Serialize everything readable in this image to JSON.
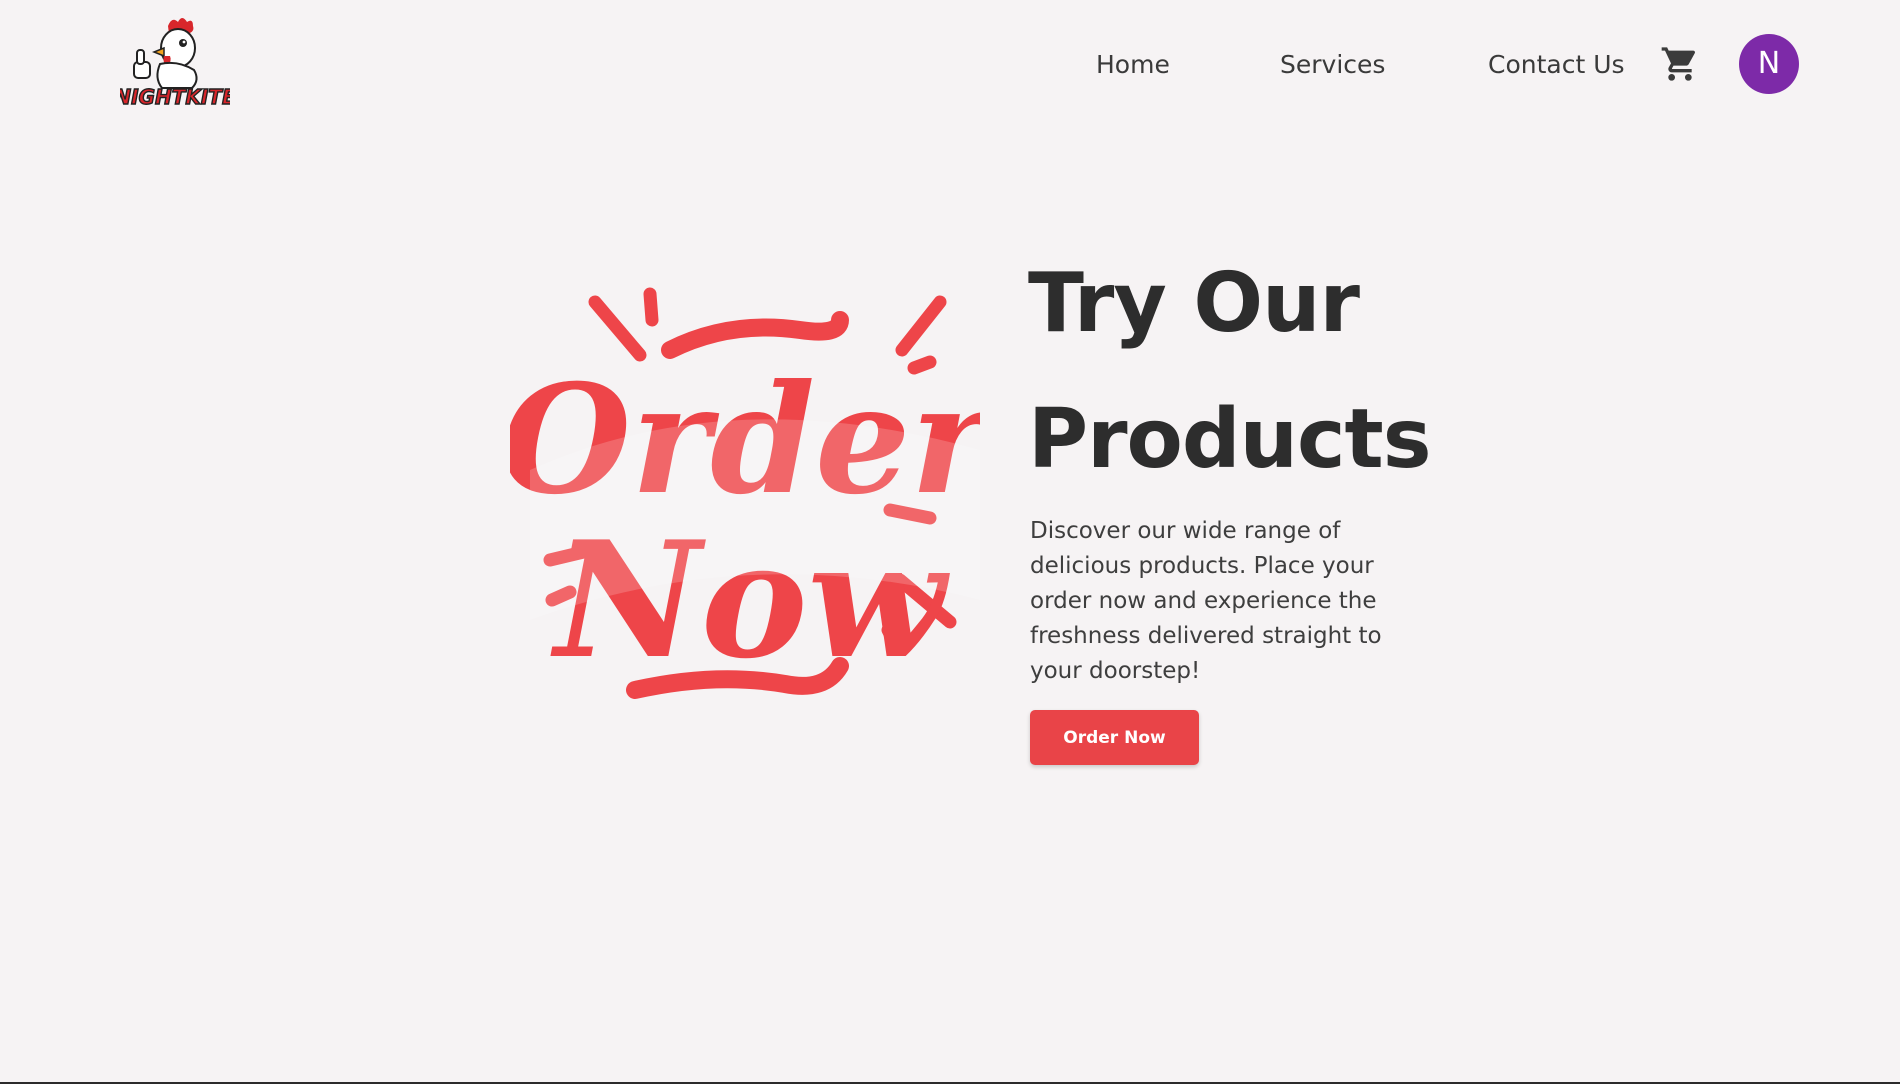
{
  "header": {
    "logo_text": "NIGHTKITE",
    "nav": [
      {
        "label": "Home"
      },
      {
        "label": "Services"
      },
      {
        "label": "Contact Us"
      }
    ],
    "cart_icon": "shopping-cart-icon",
    "avatar_initial": "N"
  },
  "hero": {
    "art_text_line1": "Order",
    "art_text_line2": "Now",
    "title_line1": "Try Our",
    "title_line2": "Products",
    "description": "Discover our wide range of delicious products. Place your order now and experience the freshness delivered straight to your doorstep!",
    "cta_label": "Order Now"
  },
  "colors": {
    "accent": "#e94448",
    "avatar": "#7d2aa8",
    "background": "#f6f3f4",
    "text": "#2d2d2d"
  }
}
